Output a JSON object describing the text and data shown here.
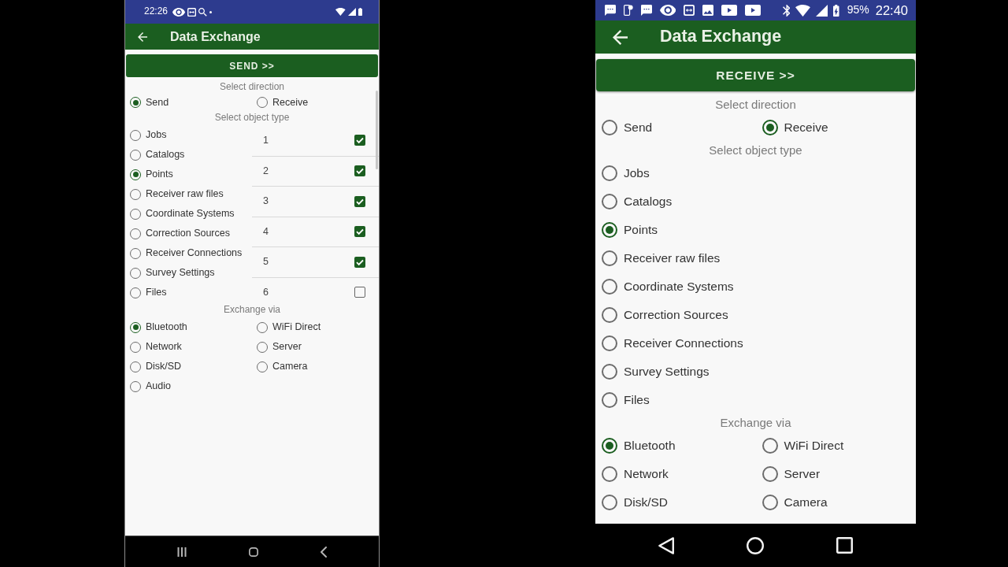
{
  "screens": [
    {
      "kind": "compact",
      "status_bar": {
        "time": "22:26"
      },
      "app_bar": {
        "title": "Data Exchange"
      },
      "action_button": {
        "label": "SEND >>"
      },
      "direction": {
        "heading": "Select direction",
        "options": [
          {
            "label": "Send",
            "selected": true
          },
          {
            "label": "Receive",
            "selected": false
          }
        ]
      },
      "object_type": {
        "heading": "Select object type",
        "options": [
          {
            "label": "Jobs",
            "selected": false
          },
          {
            "label": "Catalogs",
            "selected": false
          },
          {
            "label": "Points",
            "selected": true
          },
          {
            "label": "Receiver raw files",
            "selected": false
          },
          {
            "label": "Coordinate Systems",
            "selected": false
          },
          {
            "label": "Correction Sources",
            "selected": false
          },
          {
            "label": "Receiver Connections",
            "selected": false
          },
          {
            "label": "Survey Settings",
            "selected": false
          },
          {
            "label": "Files",
            "selected": false
          }
        ],
        "items": [
          {
            "label": "1",
            "checked": true
          },
          {
            "label": "2",
            "checked": true
          },
          {
            "label": "3",
            "checked": true
          },
          {
            "label": "4",
            "checked": true
          },
          {
            "label": "5",
            "checked": true
          },
          {
            "label": "6",
            "checked": false
          }
        ]
      },
      "exchange": {
        "heading": "Exchange via",
        "options": [
          {
            "label": "Bluetooth",
            "selected": true
          },
          {
            "label": "WiFi Direct",
            "selected": false
          },
          {
            "label": "Network",
            "selected": false
          },
          {
            "label": "Server",
            "selected": false
          },
          {
            "label": "Disk/SD",
            "selected": false
          },
          {
            "label": "Camera",
            "selected": false
          },
          {
            "label": "Audio",
            "selected": false
          }
        ]
      }
    },
    {
      "kind": "regular",
      "status_bar": {
        "battery": "95%",
        "time": "22:40"
      },
      "app_bar": {
        "title": "Data Exchange"
      },
      "action_button": {
        "label": "RECEIVE >>"
      },
      "direction": {
        "heading": "Select direction",
        "options": [
          {
            "label": "Send",
            "selected": false
          },
          {
            "label": "Receive",
            "selected": true
          }
        ]
      },
      "object_type": {
        "heading": "Select object type",
        "options": [
          {
            "label": "Jobs",
            "selected": false
          },
          {
            "label": "Catalogs",
            "selected": false
          },
          {
            "label": "Points",
            "selected": true
          },
          {
            "label": "Receiver raw files",
            "selected": false
          },
          {
            "label": "Coordinate Systems",
            "selected": false
          },
          {
            "label": "Correction Sources",
            "selected": false
          },
          {
            "label": "Receiver Connections",
            "selected": false
          },
          {
            "label": "Survey Settings",
            "selected": false
          },
          {
            "label": "Files",
            "selected": false
          }
        ]
      },
      "exchange": {
        "heading": "Exchange via",
        "options": [
          {
            "label": "Bluetooth",
            "selected": true
          },
          {
            "label": "WiFi Direct",
            "selected": false
          },
          {
            "label": "Network",
            "selected": false
          },
          {
            "label": "Server",
            "selected": false
          },
          {
            "label": "Disk/SD",
            "selected": false
          },
          {
            "label": "Camera",
            "selected": false
          }
        ]
      }
    }
  ]
}
